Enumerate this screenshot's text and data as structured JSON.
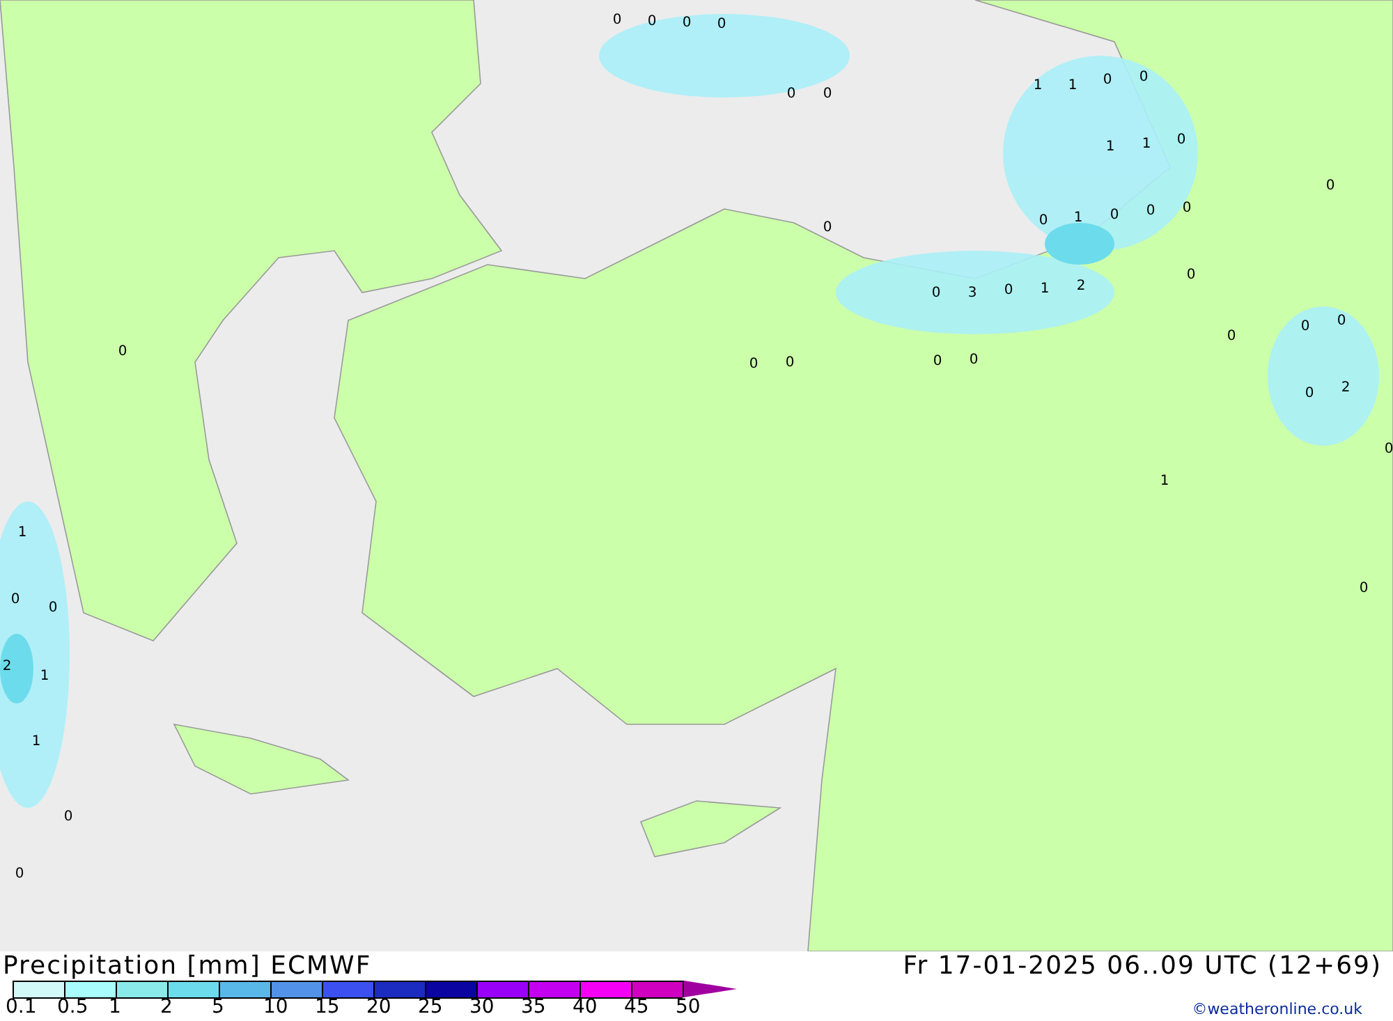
{
  "map": {
    "values": [
      "0",
      "0",
      "0",
      "0",
      "0",
      "0",
      "1",
      "1",
      "0",
      "0",
      "1",
      "1",
      "0",
      "0",
      "0",
      "0",
      "1",
      "0",
      "0",
      "0",
      "0",
      "0",
      "3",
      "0",
      "1",
      "2",
      "0",
      "0",
      "0",
      "0",
      "0",
      "0",
      "0",
      "0",
      "0",
      "2",
      "0",
      "1",
      "1",
      "0",
      "0",
      "2",
      "1",
      "1",
      "0",
      "0",
      "0"
    ]
  },
  "footer": {
    "title": "Precipitation [mm] ECMWF",
    "date": "Fr 17-01-2025 06..09 UTC (12+69)",
    "credit": "©weatheronline.co.uk"
  },
  "legend": {
    "items": [
      {
        "label": "0.1",
        "color": "#d2f8f8"
      },
      {
        "label": "0.5",
        "color": "#a8fcfc"
      },
      {
        "label": "1",
        "color": "#8aeaea"
      },
      {
        "label": "2",
        "color": "#6cdcec"
      },
      {
        "label": "5",
        "color": "#5ab8e8"
      },
      {
        "label": "10",
        "color": "#5292e8"
      },
      {
        "label": "15",
        "color": "#3c50f0"
      },
      {
        "label": "20",
        "color": "#1c2cc0"
      },
      {
        "label": "25",
        "color": "#0c04a0"
      },
      {
        "label": "30",
        "color": "#9800f8"
      },
      {
        "label": "35",
        "color": "#c400f0"
      },
      {
        "label": "40",
        "color": "#f400f4"
      },
      {
        "label": "45",
        "color": "#d000c0"
      },
      {
        "kind": "arrow",
        "color": "#a000a0"
      }
    ],
    "end_label": "50"
  }
}
